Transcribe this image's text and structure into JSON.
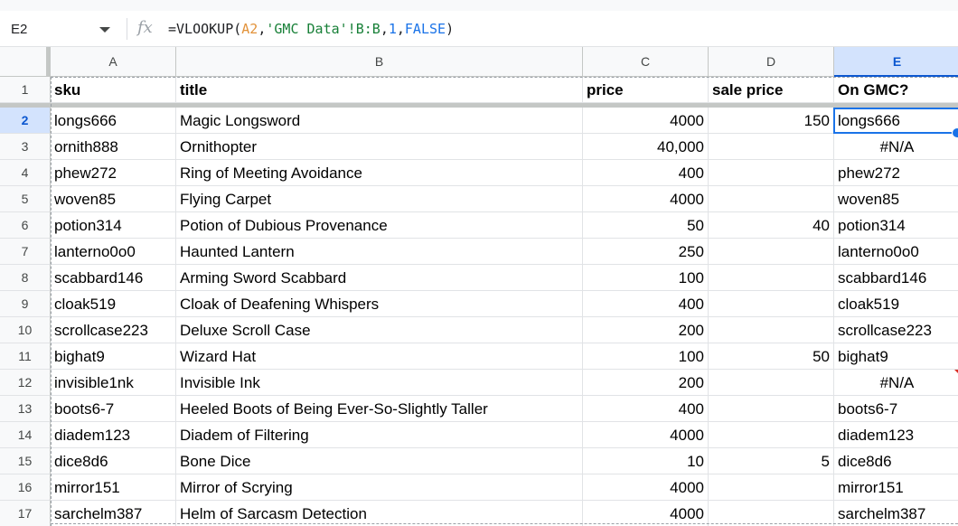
{
  "namebox": {
    "value": "E2"
  },
  "formula": {
    "prefix": "=VLOOKUP(",
    "arg1": "A2",
    "sep1": ",",
    "arg2": "'GMC Data'!B:B",
    "sep2": ",",
    "arg3": "1",
    "sep3": ",",
    "arg4": "FALSE",
    "suffix": ")"
  },
  "icons": {
    "formula": "fx-icon",
    "namebox_dropdown": "chevron-down-icon"
  },
  "colors": {
    "selection": "#1a73e8",
    "error_marker": "#d93025",
    "header_selected_bg": "#d3e3fd"
  },
  "columns": [
    "A",
    "B",
    "C",
    "D",
    "E"
  ],
  "selected": {
    "column": "E",
    "row": 2
  },
  "rows": [
    {
      "num": "1",
      "a": "sku",
      "b": "title",
      "c": "price",
      "d": "sale price",
      "e": "On GMC?"
    },
    {
      "num": "2",
      "a": "longs666",
      "b": "Magic Longsword",
      "c": "4000",
      "d": "150",
      "e": "longs666"
    },
    {
      "num": "3",
      "a": "ornith888",
      "b": "Ornithopter",
      "c": "40,000",
      "d": "",
      "e": "#N/A"
    },
    {
      "num": "4",
      "a": "phew272",
      "b": "Ring of Meeting Avoidance",
      "c": "400",
      "d": "",
      "e": "phew272"
    },
    {
      "num": "5",
      "a": "woven85",
      "b": "Flying Carpet",
      "c": "4000",
      "d": "",
      "e": "woven85"
    },
    {
      "num": "6",
      "a": "potion314",
      "b": "Potion of Dubious Provenance",
      "c": "50",
      "d": "40",
      "e": "potion314"
    },
    {
      "num": "7",
      "a": "lanterno0o0",
      "b": "Haunted Lantern",
      "c": "250",
      "d": "",
      "e": "lanterno0o0"
    },
    {
      "num": "8",
      "a": "scabbard146",
      "b": "Arming Sword Scabbard",
      "c": "100",
      "d": "",
      "e": "scabbard146"
    },
    {
      "num": "9",
      "a": "cloak519",
      "b": "Cloak of Deafening Whispers",
      "c": "400",
      "d": "",
      "e": "cloak519"
    },
    {
      "num": "10",
      "a": "scrollcase223",
      "b": "Deluxe Scroll Case",
      "c": "200",
      "d": "",
      "e": "scrollcase223"
    },
    {
      "num": "11",
      "a": "bighat9",
      "b": "Wizard Hat",
      "c": "100",
      "d": "50",
      "e": "bighat9"
    },
    {
      "num": "12",
      "a": "invisible1nk",
      "b": "Invisible Ink",
      "c": "200",
      "d": "",
      "e": "#N/A"
    },
    {
      "num": "13",
      "a": "boots6-7",
      "b": "Heeled Boots of Being Ever-So-Slightly Taller",
      "c": "400",
      "d": "",
      "e": "boots6-7"
    },
    {
      "num": "14",
      "a": "diadem123",
      "b": "Diadem of Filtering",
      "c": "4000",
      "d": "",
      "e": "diadem123"
    },
    {
      "num": "15",
      "a": "dice8d6",
      "b": "Bone Dice",
      "c": "10",
      "d": "5",
      "e": "dice8d6"
    },
    {
      "num": "16",
      "a": "mirror151",
      "b": "Mirror of Scrying",
      "c": "4000",
      "d": "",
      "e": "mirror151"
    },
    {
      "num": "17",
      "a": "sarchelm387",
      "b": "Helm of Sarcasm Detection",
      "c": "4000",
      "d": "",
      "e": "sarchelm387"
    }
  ]
}
